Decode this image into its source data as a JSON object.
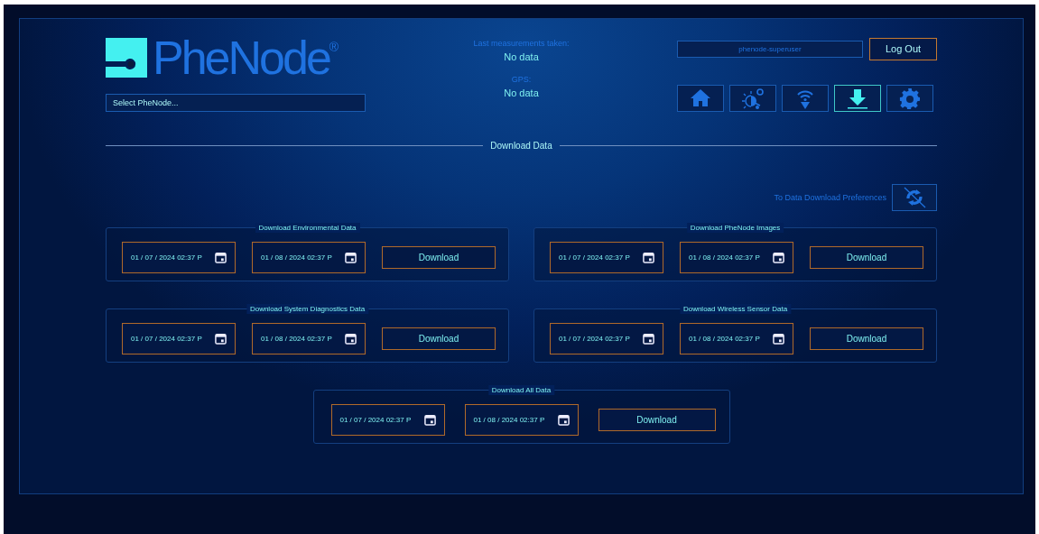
{
  "header": {
    "logo": "PheNode$^{®}$",
    "select": {
      "placeholder": "Select PheNode..."
    }
  },
  "status": [
    {
      "label": "Last measurements taken:",
      "value": "No data"
    },
    {
      "label": "GPS:",
      "value": "No data"
    }
  ],
  "user": {
    "name": "phenode-superuser",
    "logout": "Log Out"
  },
  "nav": [
    {
      "kind": "home",
      "selected": false
    },
    {
      "kind": "sun",
      "selected": false
    },
    {
      "kind": "wireless",
      "selected": false
    },
    {
      "kind": "download",
      "selected": true
    },
    {
      "kind": "settings",
      "selected": false
    }
  ],
  "section_title": "Download Data",
  "preferences_link": "To Data Download Preferences",
  "panels": [
    {
      "title": "Download Environmental Data",
      "start": "01 / 07 / 2024 02:37 P",
      "end": "01 / 08 / 2024 02:37 P",
      "button": "Download"
    },
    {
      "title": "Download PheNode Images",
      "start": "01 / 07 / 2024 02:37 P",
      "end": "01 / 08 / 2024 02:37 P",
      "button": "Download"
    },
    {
      "title": "Download System Diagnostics Data",
      "start": "01 / 07 / 2024 02:37 P",
      "end": "01 / 08 / 2024 02:37 P",
      "button": "Download"
    },
    {
      "title": "Download Wireless Sensor Data",
      "start": "01 / 07 / 2024 02:37 P",
      "end": "01 / 08 / 2024 02:37 P",
      "button": "Download"
    },
    {
      "title": "Download All Data",
      "start": "01 / 07 / 2024 02:37 P",
      "end": "01 / 08 / 2024 02:37 P",
      "button": "Download"
    }
  ]
}
